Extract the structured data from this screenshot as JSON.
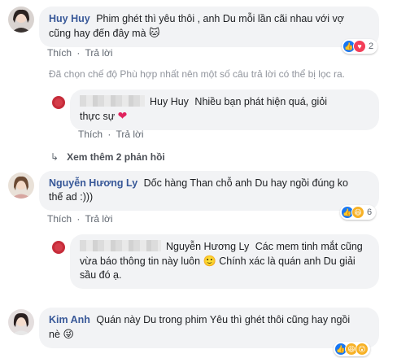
{
  "comments": [
    {
      "author": "Huy Huy",
      "text_line1": "Phim ghét thì yêu thôi , anh Du mỗi lần cãi nhau với vợ",
      "text_line2": "cũng hay đến đây mà",
      "emoji": "🐱",
      "like_label": "Thích",
      "reply_label": "Trả lời",
      "reaction_count": "2"
    },
    {
      "author": "Nguyễn Hương Ly",
      "text_line1": "Dốc hàng Than chỗ anh Du hay ngồi đúng ko",
      "text_line2": "thế ad :)))",
      "like_label": "Thích",
      "reply_label": "Trả lời",
      "reaction_count": "6"
    },
    {
      "author": "Kim Anh",
      "text_line1": "Quán này Du trong phim Yêu thì ghét thôi cũng hay ngồi",
      "text_line2": "nè",
      "emoji": "😜"
    }
  ],
  "filter_notice": "Đã chọn chế độ Phù hợp nhất nên một số câu trả lời có thể bị lọc ra.",
  "replies": [
    {
      "mention": "Huy Huy",
      "text_line1": "Nhiều bạn phát hiện quá, giỏi",
      "text_line2": "thực sự",
      "emoji": "❤",
      "like_label": "Thích",
      "reply_label": "Trả lời"
    },
    {
      "mention": "Nguyễn Hương Ly",
      "text_line1": "Các mem tinh mắt cũng",
      "text_line2": "vừa báo thông tin này luôn",
      "emoji": "🙂",
      "text_line2b": "Chính xác là quán anh Du giải",
      "text_line3": "sầu đó ạ.",
      "like_label": "Thích",
      "reply_label": "Trả lời"
    }
  ],
  "view_more": "Xem thêm 2 phản hồi",
  "colors": {
    "link": "#385898",
    "bubble": "#f2f3f5",
    "meta": "#606770"
  }
}
